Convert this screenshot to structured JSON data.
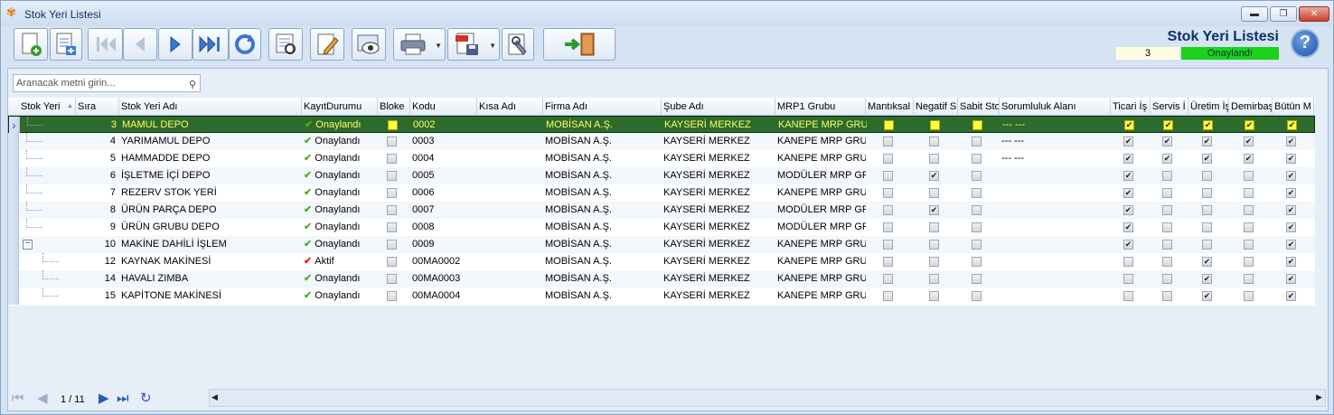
{
  "window": {
    "title": "Stok Yeri Listesi",
    "min_label": "▬",
    "max_label": "❐",
    "close_label": "✕"
  },
  "header": {
    "title": "Stok Yeri Listesi",
    "record_count": "3",
    "status": "Onaylandı",
    "help_label": "?"
  },
  "toolbar": {
    "buttons": [
      {
        "name": "new-document-button",
        "icon": "new-document-icon"
      },
      {
        "name": "add-line-button",
        "icon": "add-list-icon"
      },
      {
        "name": "first-record-button",
        "icon": "first-icon"
      },
      {
        "name": "previous-record-button",
        "icon": "previous-icon"
      },
      {
        "name": "next-record-button",
        "icon": "next-icon"
      },
      {
        "name": "last-record-button",
        "icon": "last-icon"
      },
      {
        "name": "refresh-button",
        "icon": "refresh-icon"
      },
      {
        "name": "report-preview-button",
        "icon": "report-icon"
      },
      {
        "name": "edit-button",
        "icon": "edit-icon"
      },
      {
        "name": "view-button",
        "icon": "eye-icon"
      },
      {
        "name": "print-button",
        "icon": "printer-icon"
      },
      {
        "name": "pdf-export-button",
        "icon": "pdf-icon"
      },
      {
        "name": "settings-button",
        "icon": "wrench-icon"
      },
      {
        "name": "exit-button",
        "icon": "exit-door-icon"
      }
    ]
  },
  "search": {
    "placeholder": "Aranacak metni girin..."
  },
  "grid": {
    "columns": [
      "Stok Yeri",
      "Sıra",
      "Stok Yeri Adı",
      "KayıtDurumu",
      "Bloke",
      "Kodu",
      "Kısa Adı",
      "Firma Adı",
      "Şube Adı",
      "MRP1 Grubu",
      "Mantıksal",
      "Negatif S",
      "Sabit Sto",
      "Sorumluluk Alanı",
      "Ticari İş",
      "Servis İ",
      "Üretim İş",
      "Demirbaş",
      "Bütün M"
    ],
    "rows": [
      {
        "sira": "3",
        "ad": "MAMUL DEPO",
        "durum": "Onaylandı",
        "durum_ok": true,
        "bloke": false,
        "kodu": "0002",
        "kisa": "",
        "firma": "MOBİSAN A.Ş.",
        "sube": "KAYSERİ MERKEZ",
        "mrp": "KANEPE MRP GRUP",
        "mantiksal": false,
        "negatif": false,
        "sabit": false,
        "sorumluluk": "--- ---",
        "ticari": true,
        "servis": true,
        "uretim": true,
        "demirbas": true,
        "butun": true,
        "tree": "child"
      },
      {
        "sira": "4",
        "ad": "YARIMAMUL DEPO",
        "durum": "Onaylandı",
        "durum_ok": true,
        "bloke": false,
        "kodu": "0003",
        "kisa": "",
        "firma": "MOBİSAN A.Ş.",
        "sube": "KAYSERİ MERKEZ",
        "mrp": "KANEPE MRP GRUP",
        "mantiksal": false,
        "negatif": false,
        "sabit": false,
        "sorumluluk": "--- ---",
        "ticari": true,
        "servis": true,
        "uretim": true,
        "demirbas": true,
        "butun": true,
        "tree": "child"
      },
      {
        "sira": "5",
        "ad": "HAMMADDE DEPO",
        "durum": "Onaylandı",
        "durum_ok": true,
        "bloke": false,
        "kodu": "0004",
        "kisa": "",
        "firma": "MOBİSAN A.Ş.",
        "sube": "KAYSERİ MERKEZ",
        "mrp": "KANEPE MRP GRUP",
        "mantiksal": false,
        "negatif": false,
        "sabit": false,
        "sorumluluk": "--- ---",
        "ticari": true,
        "servis": true,
        "uretim": true,
        "demirbas": true,
        "butun": true,
        "tree": "child"
      },
      {
        "sira": "6",
        "ad": "İŞLETME İÇİ DEPO",
        "durum": "Onaylandı",
        "durum_ok": true,
        "bloke": false,
        "kodu": "0005",
        "kisa": "",
        "firma": "MOBİSAN A.Ş.",
        "sube": "KAYSERİ MERKEZ",
        "mrp": "MODÜLER MRP GRU",
        "mantiksal": false,
        "negatif": true,
        "sabit": false,
        "sorumluluk": "",
        "ticari": true,
        "servis": false,
        "uretim": false,
        "demirbas": false,
        "butun": true,
        "tree": "child"
      },
      {
        "sira": "7",
        "ad": "REZERV STOK YERİ",
        "durum": "Onaylandı",
        "durum_ok": true,
        "bloke": false,
        "kodu": "0006",
        "kisa": "",
        "firma": "MOBİSAN A.Ş.",
        "sube": "KAYSERİ MERKEZ",
        "mrp": "KANEPE MRP GRUP",
        "mantiksal": false,
        "negatif": false,
        "sabit": false,
        "sorumluluk": "",
        "ticari": true,
        "servis": false,
        "uretim": false,
        "demirbas": false,
        "butun": true,
        "tree": "child"
      },
      {
        "sira": "8",
        "ad": "ÜRÜN PARÇA DEPO",
        "durum": "Onaylandı",
        "durum_ok": true,
        "bloke": false,
        "kodu": "0007",
        "kisa": "",
        "firma": "MOBİSAN A.Ş.",
        "sube": "KAYSERİ MERKEZ",
        "mrp": "MODÜLER MRP GRU",
        "mantiksal": false,
        "negatif": true,
        "sabit": false,
        "sorumluluk": "",
        "ticari": true,
        "servis": false,
        "uretim": false,
        "demirbas": false,
        "butun": true,
        "tree": "child"
      },
      {
        "sira": "9",
        "ad": "ÜRÜN GRUBU DEPO",
        "durum": "Onaylandı",
        "durum_ok": true,
        "bloke": false,
        "kodu": "0008",
        "kisa": "",
        "firma": "MOBİSAN A.Ş.",
        "sube": "KAYSERİ MERKEZ",
        "mrp": "MODÜLER MRP GRU",
        "mantiksal": false,
        "negatif": false,
        "sabit": false,
        "sorumluluk": "",
        "ticari": true,
        "servis": false,
        "uretim": false,
        "demirbas": false,
        "butun": true,
        "tree": "child"
      },
      {
        "sira": "10",
        "ad": "MAKİNE DAHİLİ İŞLEM",
        "durum": "Onaylandı",
        "durum_ok": true,
        "bloke": false,
        "kodu": "0009",
        "kisa": "",
        "firma": "MOBİSAN A.Ş.",
        "sube": "KAYSERİ MERKEZ",
        "mrp": "KANEPE MRP GRUP",
        "mantiksal": false,
        "negatif": false,
        "sabit": false,
        "sorumluluk": "",
        "ticari": true,
        "servis": false,
        "uretim": false,
        "demirbas": false,
        "butun": true,
        "tree": "parent"
      },
      {
        "sira": "12",
        "ad": "KAYNAK MAKİNESİ",
        "durum": "Aktif",
        "durum_ok": false,
        "bloke": false,
        "kodu": "00MA0002",
        "kisa": "",
        "firma": "MOBİSAN A.Ş.",
        "sube": "KAYSERİ MERKEZ",
        "mrp": "KANEPE MRP GRUP",
        "mantiksal": false,
        "negatif": false,
        "sabit": false,
        "sorumluluk": "",
        "ticari": false,
        "servis": false,
        "uretim": true,
        "demirbas": false,
        "butun": true,
        "tree": "grandchild"
      },
      {
        "sira": "14",
        "ad": "HAVALI ZIMBA",
        "durum": "Onaylandı",
        "durum_ok": true,
        "bloke": false,
        "kodu": "00MA0003",
        "kisa": "",
        "firma": "MOBİSAN A.Ş.",
        "sube": "KAYSERİ MERKEZ",
        "mrp": "KANEPE MRP GRUP",
        "mantiksal": false,
        "negatif": false,
        "sabit": false,
        "sorumluluk": "",
        "ticari": false,
        "servis": false,
        "uretim": true,
        "demirbas": false,
        "butun": true,
        "tree": "grandchild"
      },
      {
        "sira": "15",
        "ad": "KAPİTONE MAKİNESİ",
        "durum": "Onaylandı",
        "durum_ok": true,
        "bloke": false,
        "kodu": "00MA0004",
        "kisa": "",
        "firma": "MOBİSAN A.Ş.",
        "sube": "KAYSERİ MERKEZ",
        "mrp": "KANEPE MRP GRUP",
        "mantiksal": false,
        "negatif": false,
        "sabit": false,
        "sorumluluk": "",
        "ticari": false,
        "servis": false,
        "uretim": true,
        "demirbas": false,
        "butun": true,
        "tree": "grandchild-last"
      }
    ]
  },
  "pager": {
    "label": "1 / 11"
  },
  "colors": {
    "selected_row": "#2d6b2d",
    "status_green": "#1bd21b",
    "accent": "#0e2f67"
  }
}
